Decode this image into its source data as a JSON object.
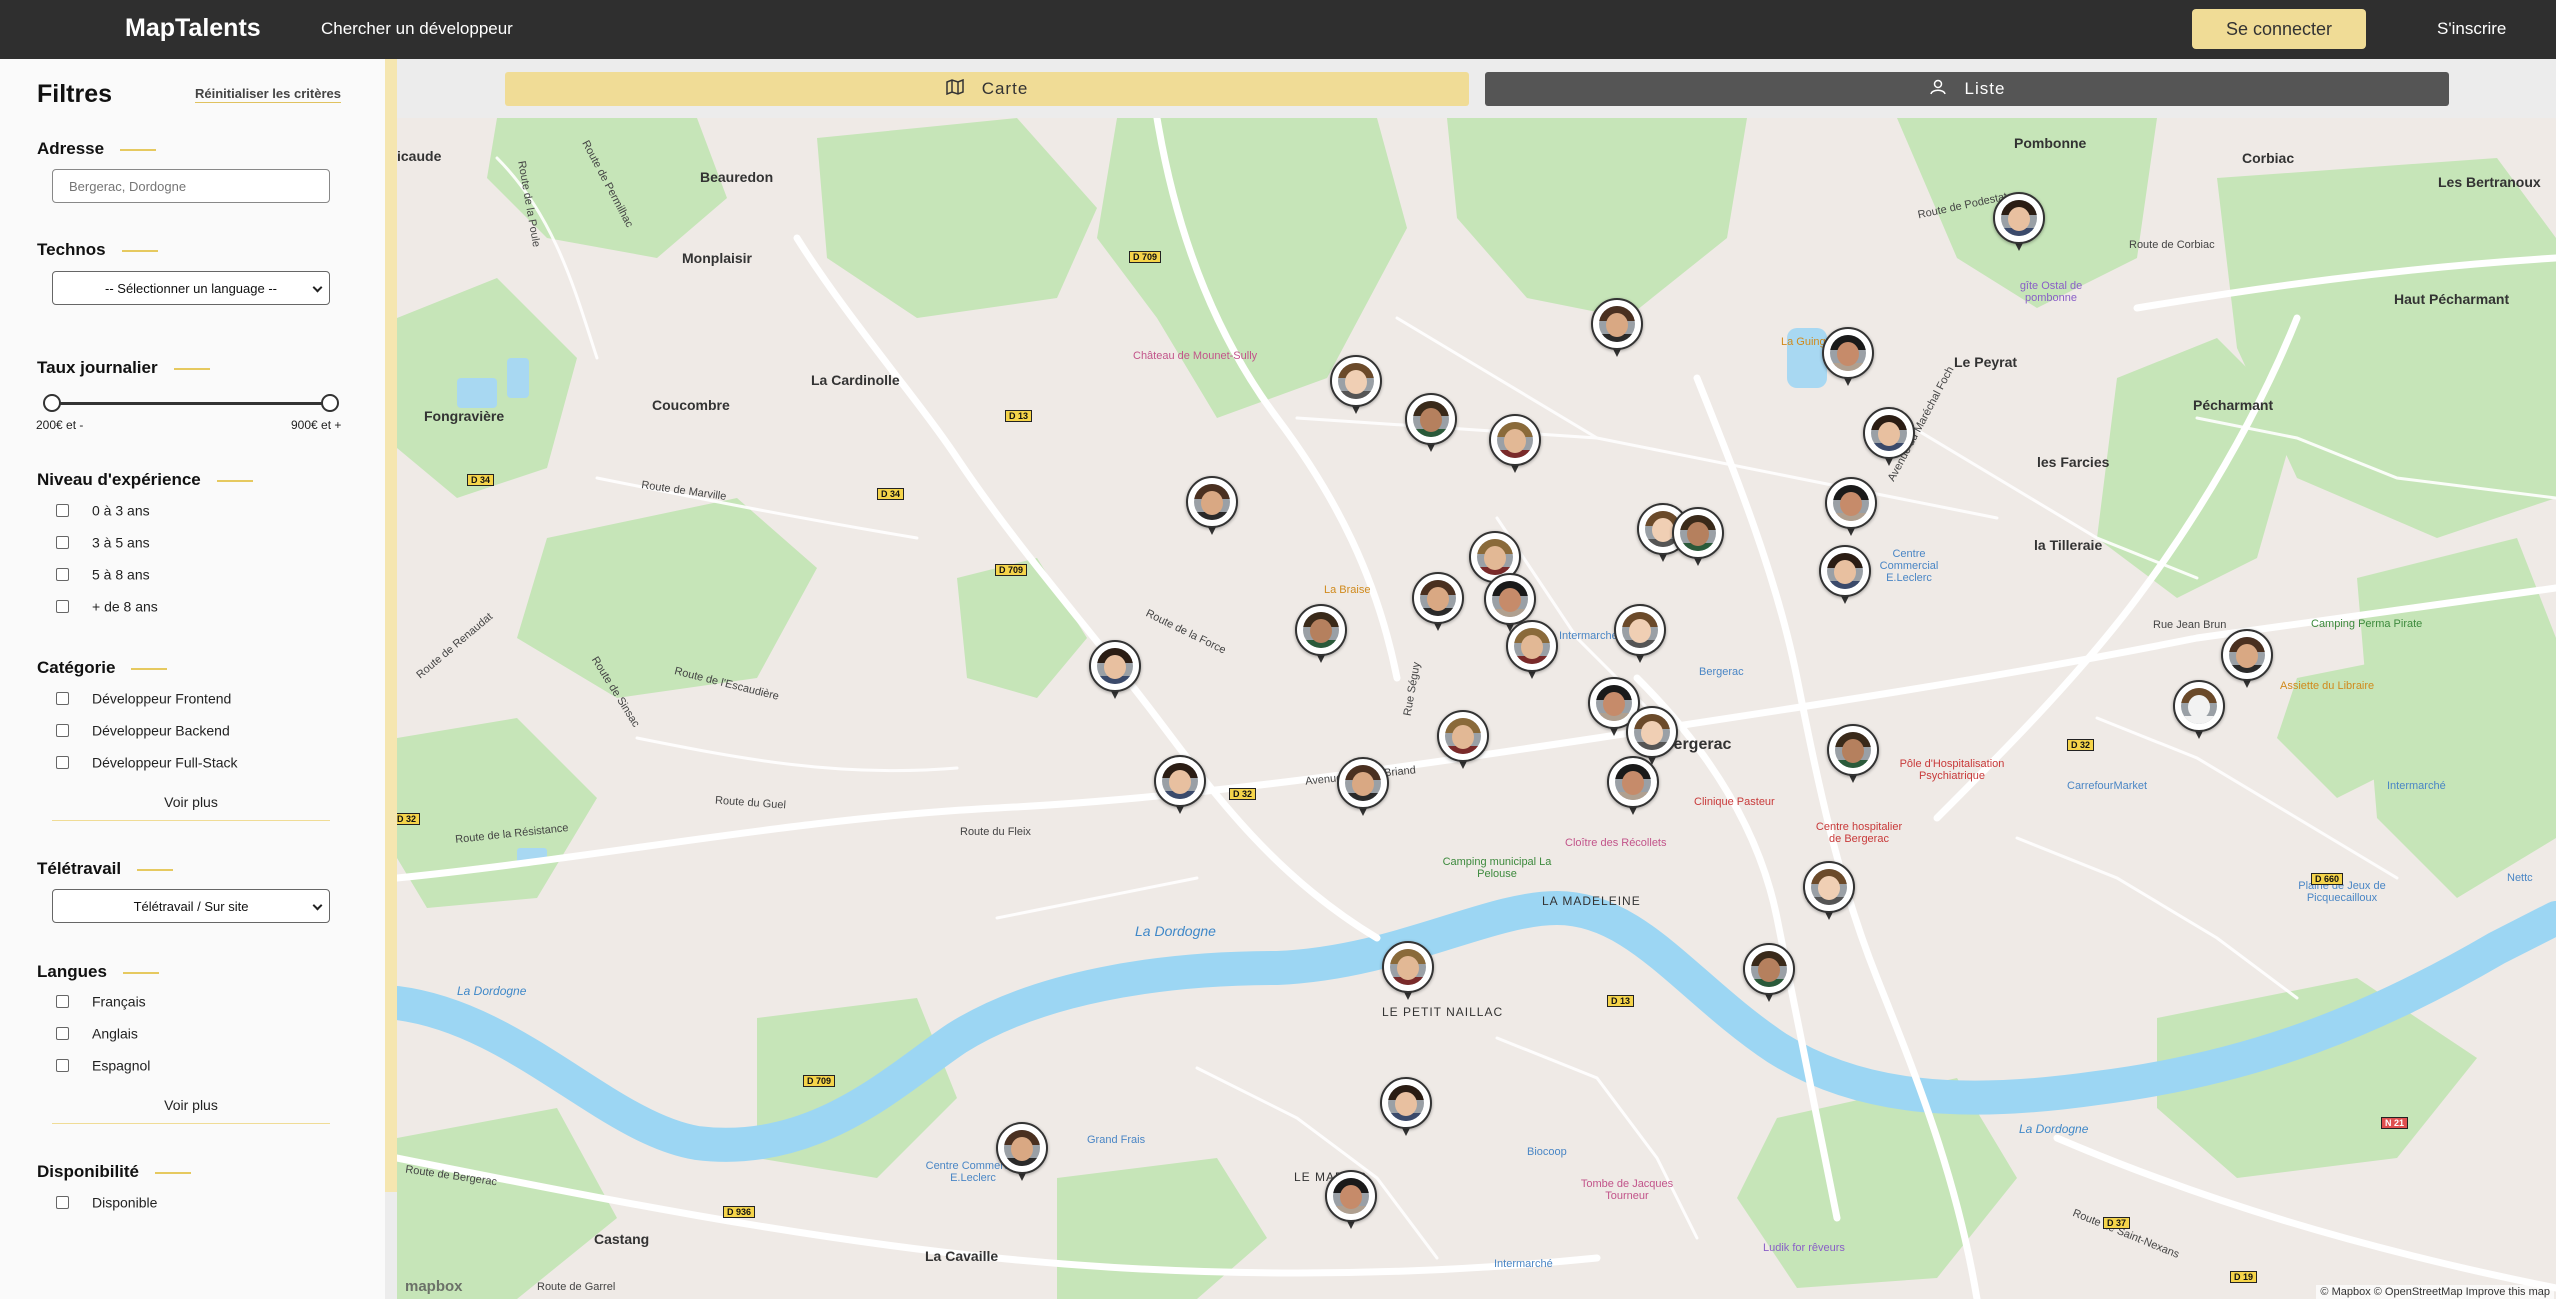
{
  "header": {
    "logo": "MapTalents",
    "nav_search": "Chercher un développeur",
    "login_label": "Se connecter",
    "register_label": "S'inscrire"
  },
  "sidebar": {
    "title": "Filtres",
    "reset_label": "Réinitialiser les critères",
    "address": {
      "label": "Adresse",
      "placeholder": "Bergerac, Dordogne"
    },
    "technos": {
      "label": "Technos",
      "selected": "-- Sélectionner un language --"
    },
    "rate": {
      "label": "Taux journalier",
      "min_label": "200€ et -",
      "max_label": "900€ et +",
      "min_value": 200,
      "max_value": 900
    },
    "experience": {
      "label": "Niveau d'expérience",
      "options": [
        "0 à 3 ans",
        "3 à 5 ans",
        "5 à 8 ans",
        "+ de 8 ans"
      ]
    },
    "category": {
      "label": "Catégorie",
      "options": [
        "Développeur Frontend",
        "Développeur Backend",
        "Développeur Full-Stack"
      ],
      "more_label": "Voir plus"
    },
    "remote": {
      "label": "Télétravail",
      "selected": "Télétravail / Sur site"
    },
    "languages": {
      "label": "Langues",
      "options": [
        "Français",
        "Anglais",
        "Espagnol"
      ],
      "more_label": "Voir plus"
    },
    "availability": {
      "label": "Disponibilité",
      "options": [
        "Disponible"
      ]
    }
  },
  "view_tabs": {
    "map_label": "Carte",
    "list_label": "Liste",
    "active": "Carte"
  },
  "map": {
    "places": [
      "Pombonne",
      "Corbiac",
      "Les Bertranoux",
      "Beauredon",
      "Monplaisir",
      "Haut Pécharmant",
      "Le Peyrat",
      "Pécharmant",
      "Coucombre",
      "La Cardinolle",
      "Fongravière",
      "les Farcies",
      "la Tilleraie",
      "Bergerac",
      "LA MADELEINE",
      "LE PETIT NAILLAC",
      "LE MARAIS",
      "Castang",
      "La Cavaille",
      "icaude"
    ],
    "water": [
      "La Dordogne",
      "La Dordogne",
      "La Dordogne"
    ],
    "pois": [
      "Château de Mounet-Sully",
      "La Guinguette",
      "gîte Ostal de pombonne",
      "Centre Commercial E.Leclerc",
      "La Braise",
      "Intermarché",
      "Bergerac",
      "Rue Jean Brun",
      "Camping Perma Pirate",
      "Assiette du Libraire",
      "Pôle d'Hospitalisation Psychiatrique",
      "CarrefourMarket",
      "Intermarché",
      "Centre hospitalier de Bergerac",
      "Clinique Pasteur",
      "Cloître des Récollets",
      "Camping municipal La Pelouse",
      "Plaine de Jeux de Picquecailloux",
      "Grand Frais",
      "Centre Commercial E.Leclerc",
      "Biocoop",
      "Tombe de Jacques Tourneur",
      "Intermarché",
      "Ludik for rêveurs",
      "Nettc"
    ],
    "roads": [
      "Route de Permilhac",
      "Route de la Poule",
      "Route de Marville",
      "Route de la Force",
      "Route de l'Escaudière",
      "Route de Sinsac",
      "Route de Renaudat",
      "Route de la Résistance",
      "Route du Guel",
      "Route du Fleix",
      "Avenue Aristide Briand",
      "Rue Séguy",
      "Route de Podestat",
      "Route de Corbiac",
      "Route de Bergerac",
      "Route de Saint-Nexans",
      "Avenue du Maréchal Foch",
      "Route de Garrel"
    ],
    "shields": [
      "D 709",
      "D 13",
      "D 34",
      "D 34",
      "D 709",
      "D 32",
      "D 32",
      "D 32",
      "D 13",
      "D 709",
      "D 936",
      "D 660",
      "N 21",
      "D 37",
      "D 19"
    ],
    "attribution": "© Mapbox © OpenStreetMap Improve this map",
    "mapbox_logo": "mapbox",
    "developer_pin_count": 35
  }
}
